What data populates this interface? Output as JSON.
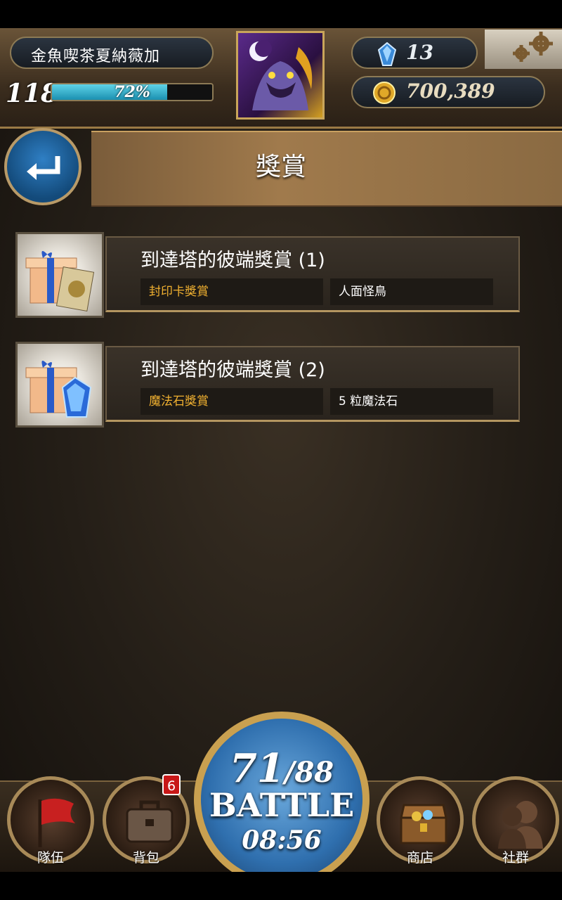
{
  "player": {
    "name": "金魚喫茶夏納薇加",
    "level": "118",
    "exp_percent": "72%",
    "exp_fraction": 0.72,
    "gems": "13",
    "gold": "700,389"
  },
  "page": {
    "title": "獎賞"
  },
  "rewards": [
    {
      "title": "到達塔的彼端獎賞 (1)",
      "type": "封印卡獎賞",
      "content": "人面怪鳥",
      "icon": "gift-with-card-icon"
    },
    {
      "title": "到達塔的彼端獎賞 (2)",
      "type": "魔法石獎賞",
      "content": "5 粒魔法石",
      "icon": "gift-with-magic-stone-icon"
    }
  ],
  "nav": {
    "team_label": "隊伍",
    "bag_label": "背包",
    "bag_badge": "6",
    "shop_label": "商店",
    "social_label": "社群"
  },
  "battle": {
    "stamina_current": "71",
    "stamina_max": "/88",
    "label": "BATTLE",
    "timer": "08:56"
  },
  "colors": {
    "reward_type": "#f0b030",
    "exp_fill": "#1a8fb0",
    "badge": "#c81818"
  }
}
